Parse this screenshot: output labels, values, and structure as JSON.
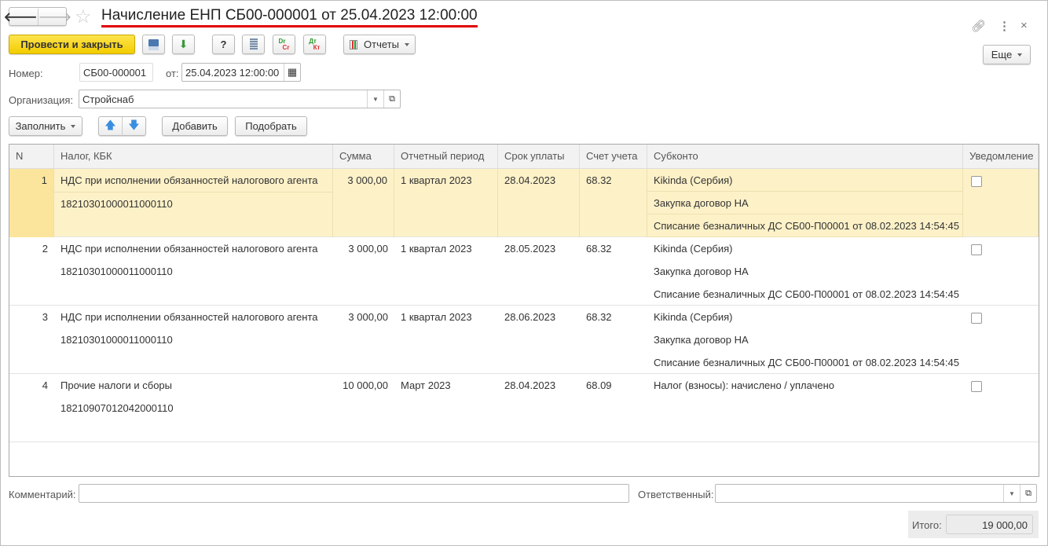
{
  "title": "Начисление ЕНП СБ00-000001 от 25.04.2023 12:00:00",
  "toolbar": {
    "post_close": "Провести и закрыть",
    "help": "?",
    "dr_cr_top": "Dr",
    "dr_cr_bottom": "Cr",
    "dt_kt_top": "Дт",
    "dt_kt_bottom": "Кт",
    "reports": "Отчеты",
    "more": "Еще"
  },
  "fields": {
    "number_label": "Номер:",
    "number_value": "СБ00-000001",
    "date_label": "от:",
    "date_value": "25.04.2023 12:00:00",
    "org_label": "Организация:",
    "org_value": "Стройснаб"
  },
  "table_toolbar": {
    "fill": "Заполнить",
    "add": "Добавить",
    "pick": "Подобрать"
  },
  "table": {
    "columns": [
      "N",
      "Налог, КБК",
      "Сумма",
      "Отчетный период",
      "Срок уплаты",
      "Счет учета",
      "Субконто",
      "Уведомление"
    ],
    "rows": [
      {
        "n": "1",
        "tax": "НДС при исполнении обязанностей налогового агента",
        "kbk": "18210301000011000110",
        "sum": "3 000,00",
        "period": "1 квартал 2023",
        "due": "28.04.2023",
        "account": "68.32",
        "subconto": [
          "Kikinda (Сербия)",
          "Закупка договор НА",
          "Списание безналичных ДС СБ00-П00001 от 08.02.2023 14:54:45"
        ],
        "notice": false,
        "selected": true
      },
      {
        "n": "2",
        "tax": "НДС при исполнении обязанностей налогового агента",
        "kbk": "18210301000011000110",
        "sum": "3 000,00",
        "period": "1 квартал 2023",
        "due": "28.05.2023",
        "account": "68.32",
        "subconto": [
          "Kikinda (Сербия)",
          "Закупка договор НА",
          "Списание безналичных ДС СБ00-П00001 от 08.02.2023 14:54:45"
        ],
        "notice": false,
        "selected": false
      },
      {
        "n": "3",
        "tax": "НДС при исполнении обязанностей налогового агента",
        "kbk": "18210301000011000110",
        "sum": "3 000,00",
        "period": "1 квартал 2023",
        "due": "28.06.2023",
        "account": "68.32",
        "subconto": [
          "Kikinda (Сербия)",
          "Закупка договор НА",
          "Списание безналичных ДС СБ00-П00001 от 08.02.2023 14:54:45"
        ],
        "notice": false,
        "selected": false
      },
      {
        "n": "4",
        "tax": "Прочие налоги и сборы",
        "kbk": "18210907012042000110",
        "sum": "10 000,00",
        "period": "Март 2023",
        "due": "28.04.2023",
        "account": "68.09",
        "subconto": [
          "Налог (взносы): начислено / уплачено"
        ],
        "notice": false,
        "selected": false
      }
    ]
  },
  "footer": {
    "comment_label": "Комментарий:",
    "comment_value": "",
    "responsible_label": "Ответственный:",
    "responsible_value": "",
    "total_label": "Итого:",
    "total_value": "19 000,00"
  },
  "colors": {
    "accent_yellow": "#f5d20a",
    "selected_row": "#fdf1c8",
    "title_underline": "#e00000"
  }
}
